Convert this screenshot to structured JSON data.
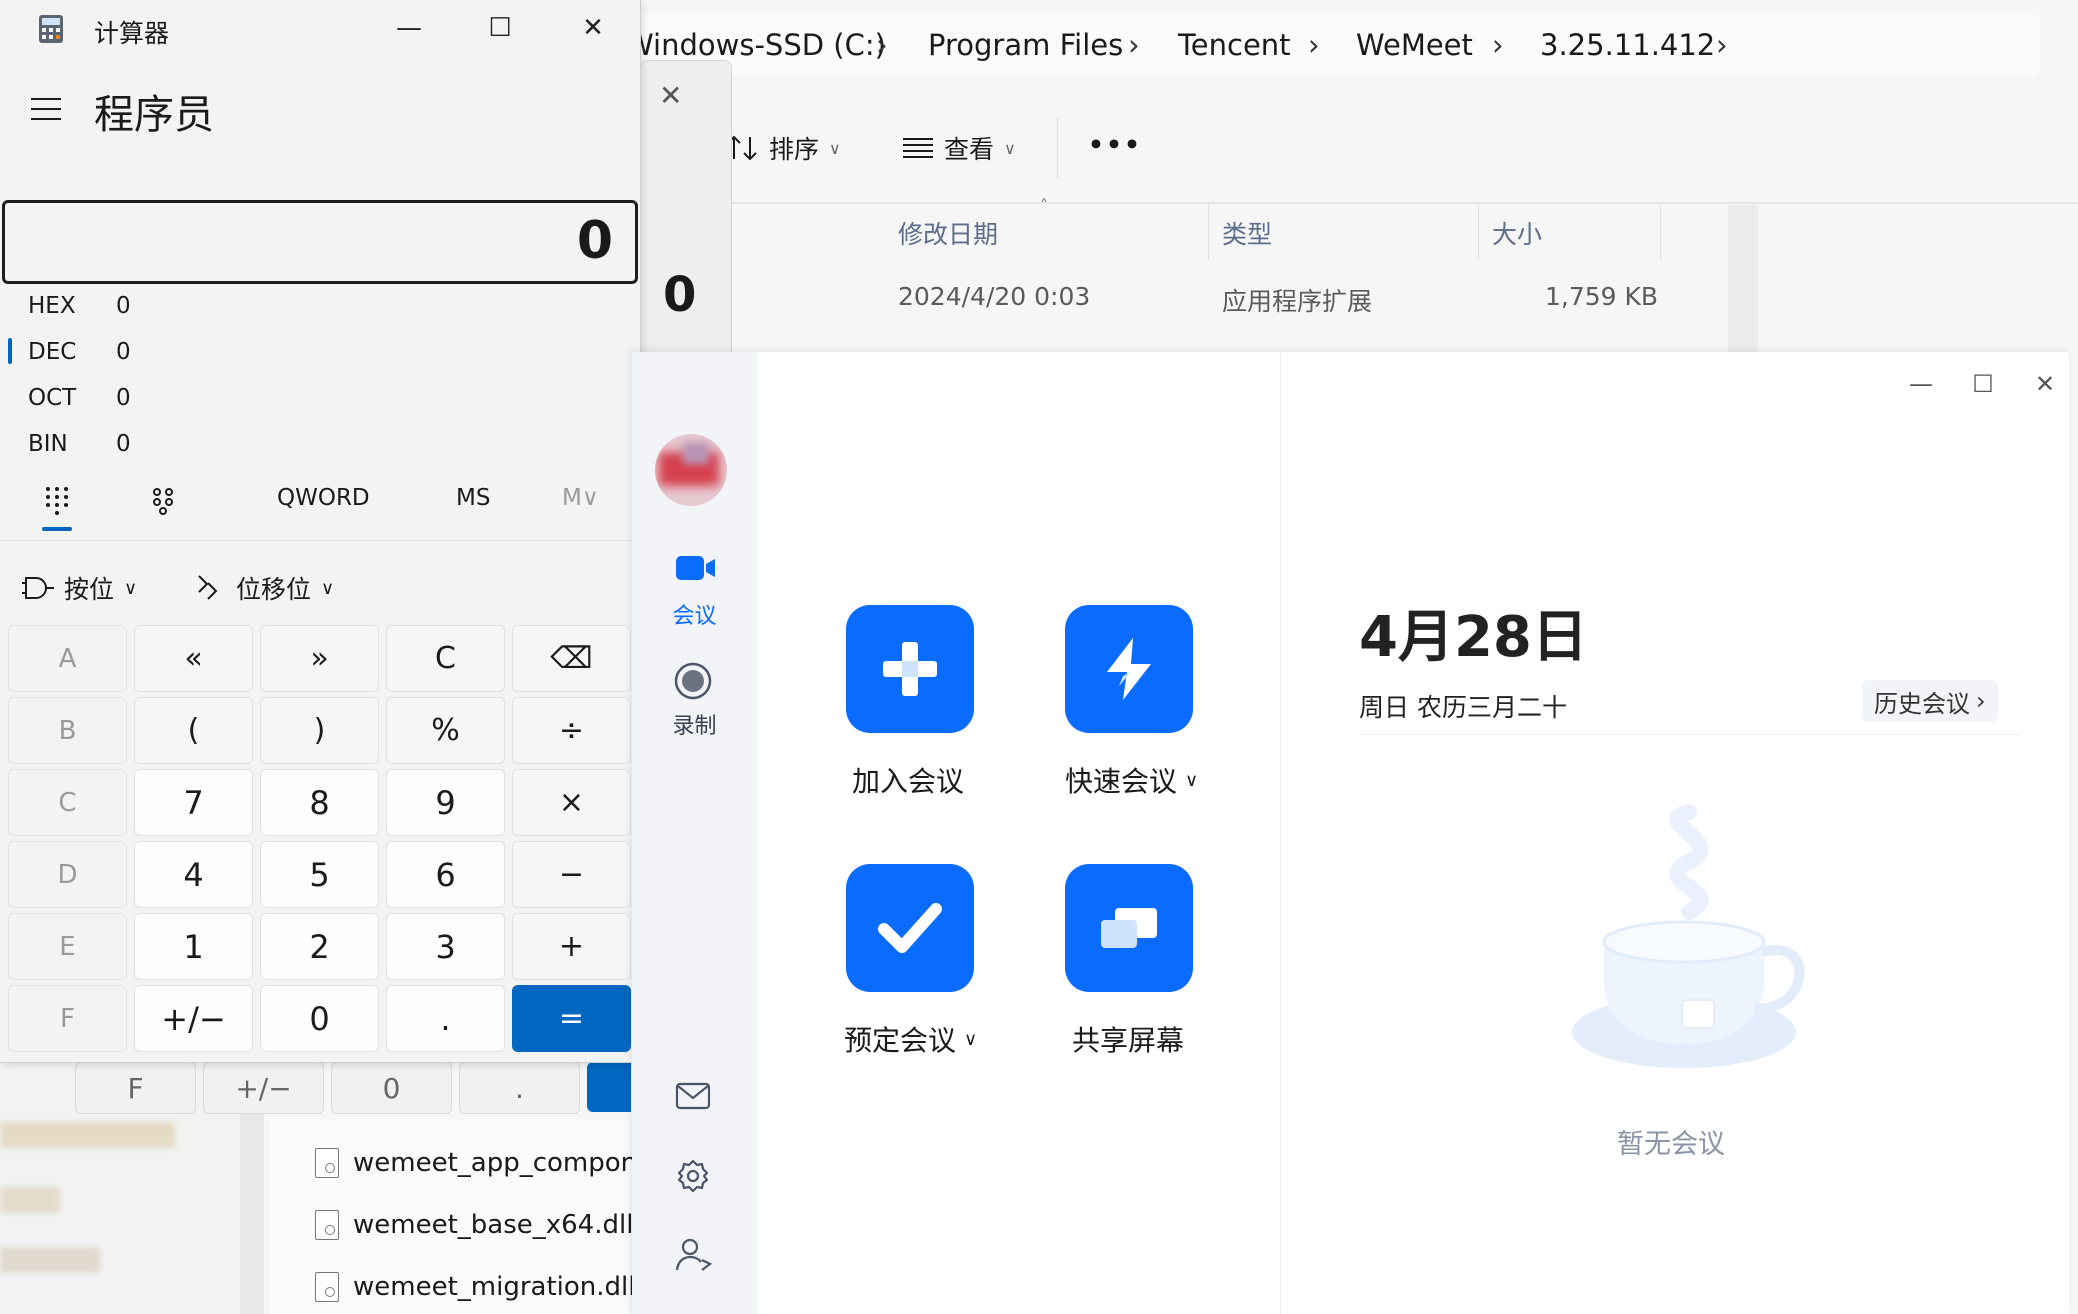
{
  "explorer": {
    "breadcrumbs": [
      "Windows-SSD (C:)",
      "Program Files",
      "Tencent",
      "WeMeet",
      "3.25.11.412"
    ],
    "toolbar": {
      "sort_label": "排序",
      "view_label": "查看",
      "more_label": "•••"
    },
    "columns": [
      "修改日期",
      "类型",
      "大小"
    ],
    "rows": [
      {
        "date": "2024/4/20 0:03",
        "type": "应用程序扩展",
        "size": "1,759 KB"
      }
    ],
    "files": [
      "wemeet_app_componen",
      "wemeet_base_x64.dll",
      "wemeet_migration.dll"
    ],
    "ghost_display": "0"
  },
  "calculator": {
    "title": "计算器",
    "mode": "程序员",
    "display": "0",
    "radix": [
      {
        "label": "HEX",
        "value": "0"
      },
      {
        "label": "DEC",
        "value": "0"
      },
      {
        "label": "OCT",
        "value": "0"
      },
      {
        "label": "BIN",
        "value": "0"
      }
    ],
    "tabs": {
      "word": "QWORD",
      "ms": "MS",
      "mlist": "M∨"
    },
    "ops": {
      "bitwise": "按位",
      "bitshift": "位移位"
    },
    "keys": [
      [
        "A",
        "«",
        "»",
        "C",
        "⌫"
      ],
      [
        "B",
        "(",
        ")",
        "%",
        "÷"
      ],
      [
        "C",
        "7",
        "8",
        "9",
        "×"
      ],
      [
        "D",
        "4",
        "5",
        "6",
        "−"
      ],
      [
        "E",
        "1",
        "2",
        "3",
        "+"
      ],
      [
        "F",
        "+/−",
        "0",
        ".",
        "="
      ]
    ],
    "ghost_keys": [
      "F",
      "+/−",
      "0",
      "."
    ]
  },
  "wemeet": {
    "nav": {
      "meetings": "会议",
      "record": "录制"
    },
    "actions": {
      "join": "加入会议",
      "quick": "快速会议",
      "schedule": "预定会议",
      "share": "共享屏幕"
    },
    "date": "4月28日",
    "date_sub": "周日 农历三月二十",
    "history": "历史会议",
    "empty": "暂无会议",
    "accent": "#0a6cff"
  }
}
